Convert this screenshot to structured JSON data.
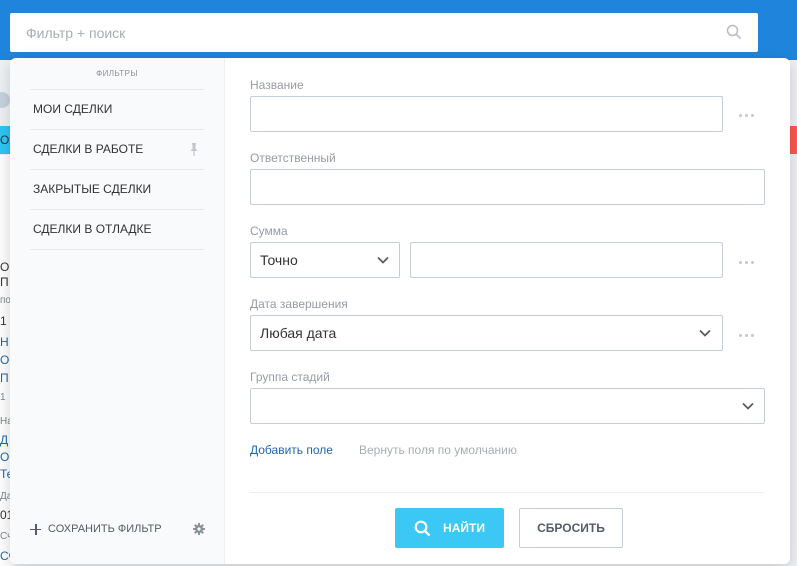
{
  "search": {
    "placeholder": "Фильтр + поиск"
  },
  "sidebar": {
    "title": "ФИЛЬТРЫ",
    "presets": [
      {
        "label": "МОИ СДЕЛКИ"
      },
      {
        "label": "СДЕЛКИ В РАБОТЕ",
        "pinned": true
      },
      {
        "label": "ЗАКРЫТЫЕ СДЕЛКИ"
      },
      {
        "label": "СДЕЛКИ В ОТЛАДКЕ"
      }
    ],
    "save_label": "СОХРАНИТЬ ФИЛЬТР"
  },
  "fields": {
    "name": {
      "label": "Название",
      "value": ""
    },
    "responsible": {
      "label": "Ответственный",
      "value": ""
    },
    "sum": {
      "label": "Сумма",
      "mode": "Точно",
      "value": ""
    },
    "close_date": {
      "label": "Дата завершения",
      "value": "Любая дата"
    },
    "stage_group": {
      "label": "Группа стадий",
      "value": ""
    }
  },
  "links": {
    "add_field": "Добавить поле",
    "restore_default": "Вернуть поля по умолчанию"
  },
  "buttons": {
    "find": "НАЙТИ",
    "reset": "СБРОСИТЬ"
  },
  "background_fragments": [
    "Ож",
    "О",
    "П",
    "по",
    "1",
    "Н",
    "О",
    "П",
    "1",
    "На",
    "Д",
    "О",
    "Те",
    "Да",
    "01",
    "Сч",
    "Сч"
  ],
  "colors": {
    "accent": "#3bc8f5",
    "link": "#2067b0",
    "header": "#1f85dc"
  }
}
